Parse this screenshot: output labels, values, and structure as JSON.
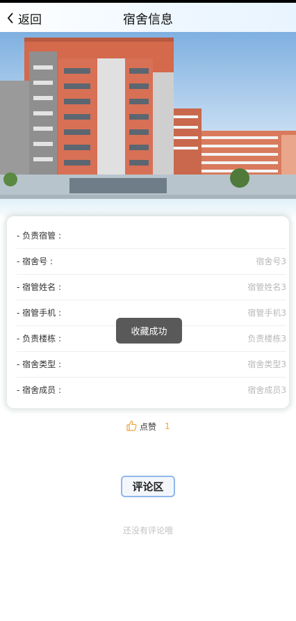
{
  "header": {
    "back_label": "返回",
    "title": "宿舍信息"
  },
  "info_rows": [
    {
      "label": "- 负责宿管 :",
      "value": ""
    },
    {
      "label": "- 宿舍号 :",
      "value": "宿舍号3"
    },
    {
      "label": "- 宿管姓名 :",
      "value": "宿管姓名3"
    },
    {
      "label": "- 宿管手机 :",
      "value": "宿管手机3"
    },
    {
      "label": "- 负责楼栋 :",
      "value": "负责楼栋3"
    },
    {
      "label": "- 宿舍类型 :",
      "value": "宿舍类型3"
    },
    {
      "label": "- 宿舍成员 :",
      "value": "宿舍成员3"
    }
  ],
  "toast": "收藏成功",
  "like": {
    "label": "点赞",
    "count": "1",
    "icon": "thumbs-up-icon",
    "color": "#e9a43a"
  },
  "comments": {
    "button_label": "评论区",
    "empty_text": "还没有评论哦"
  }
}
